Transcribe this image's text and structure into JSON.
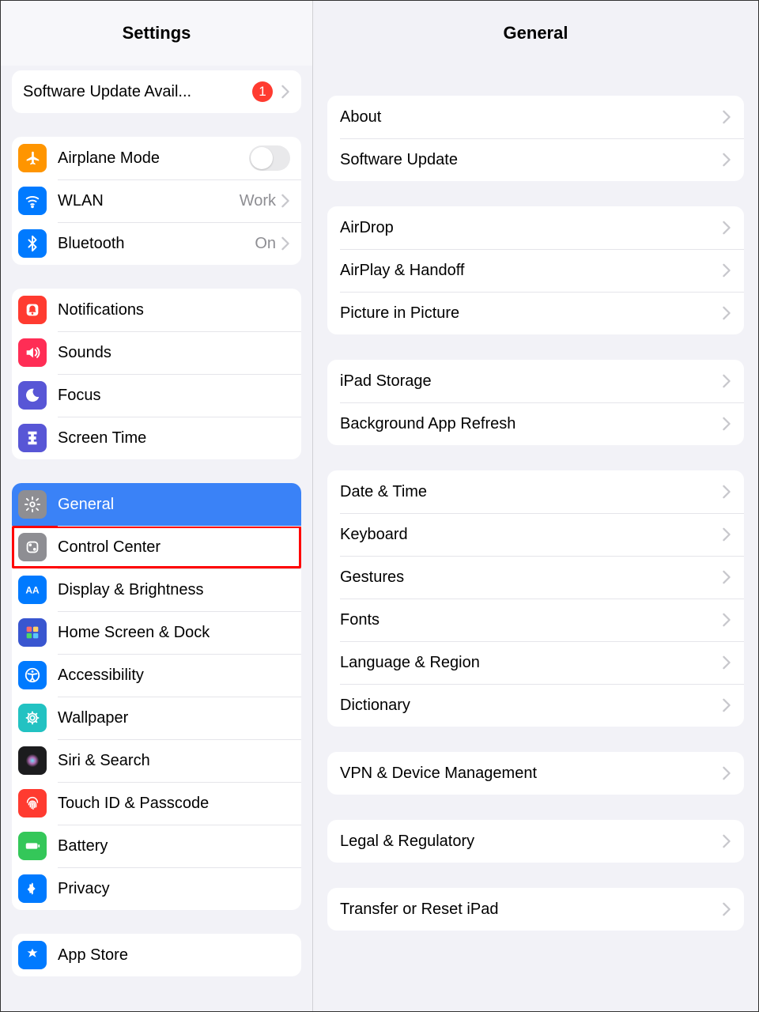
{
  "sidebar": {
    "title": "Settings",
    "banner": {
      "label": "Software Update Avail...",
      "badge": "1"
    },
    "group_network": [
      {
        "id": "airplane",
        "label": "Airplane Mode",
        "toggle": true,
        "icon_bg": "#ff9500"
      },
      {
        "id": "wlan",
        "label": "WLAN",
        "value": "Work",
        "icon_bg": "#007aff"
      },
      {
        "id": "bluetooth",
        "label": "Bluetooth",
        "value": "On",
        "icon_bg": "#007aff"
      }
    ],
    "group_notif": [
      {
        "id": "notifications",
        "label": "Notifications",
        "icon_bg": "#ff3b30"
      },
      {
        "id": "sounds",
        "label": "Sounds",
        "icon_bg": "#ff2d55"
      },
      {
        "id": "focus",
        "label": "Focus",
        "icon_bg": "#5856d6"
      },
      {
        "id": "screentime",
        "label": "Screen Time",
        "icon_bg": "#5856d6"
      }
    ],
    "group_general": [
      {
        "id": "general",
        "label": "General",
        "icon_bg": "#8e8e93",
        "selected": true
      },
      {
        "id": "controlcenter",
        "label": "Control Center",
        "icon_bg": "#8e8e93",
        "highlight": true
      },
      {
        "id": "display",
        "label": "Display & Brightness",
        "icon_bg": "#007aff"
      },
      {
        "id": "homescreen",
        "label": "Home Screen & Dock",
        "icon_bg": "#3956d0"
      },
      {
        "id": "accessibility",
        "label": "Accessibility",
        "icon_bg": "#007aff"
      },
      {
        "id": "wallpaper",
        "label": "Wallpaper",
        "icon_bg": "#22c2c2"
      },
      {
        "id": "siri",
        "label": "Siri & Search",
        "icon_bg": "#1c1c1e"
      },
      {
        "id": "touchid",
        "label": "Touch ID & Passcode",
        "icon_bg": "#ff3b30"
      },
      {
        "id": "battery",
        "label": "Battery",
        "icon_bg": "#34c759"
      },
      {
        "id": "privacy",
        "label": "Privacy",
        "icon_bg": "#007aff"
      }
    ],
    "group_store": [
      {
        "id": "appstore",
        "label": "App Store",
        "icon_bg": "#007aff"
      }
    ]
  },
  "content": {
    "title": "General",
    "groups": [
      [
        {
          "label": "About"
        },
        {
          "label": "Software Update"
        }
      ],
      [
        {
          "label": "AirDrop"
        },
        {
          "label": "AirPlay & Handoff"
        },
        {
          "label": "Picture in Picture"
        }
      ],
      [
        {
          "label": "iPad Storage"
        },
        {
          "label": "Background App Refresh"
        }
      ],
      [
        {
          "label": "Date & Time"
        },
        {
          "label": "Keyboard"
        },
        {
          "label": "Gestures"
        },
        {
          "label": "Fonts"
        },
        {
          "label": "Language & Region"
        },
        {
          "label": "Dictionary"
        }
      ],
      [
        {
          "label": "VPN & Device Management"
        }
      ],
      [
        {
          "label": "Legal & Regulatory"
        }
      ],
      [
        {
          "label": "Transfer or Reset iPad"
        }
      ]
    ]
  }
}
